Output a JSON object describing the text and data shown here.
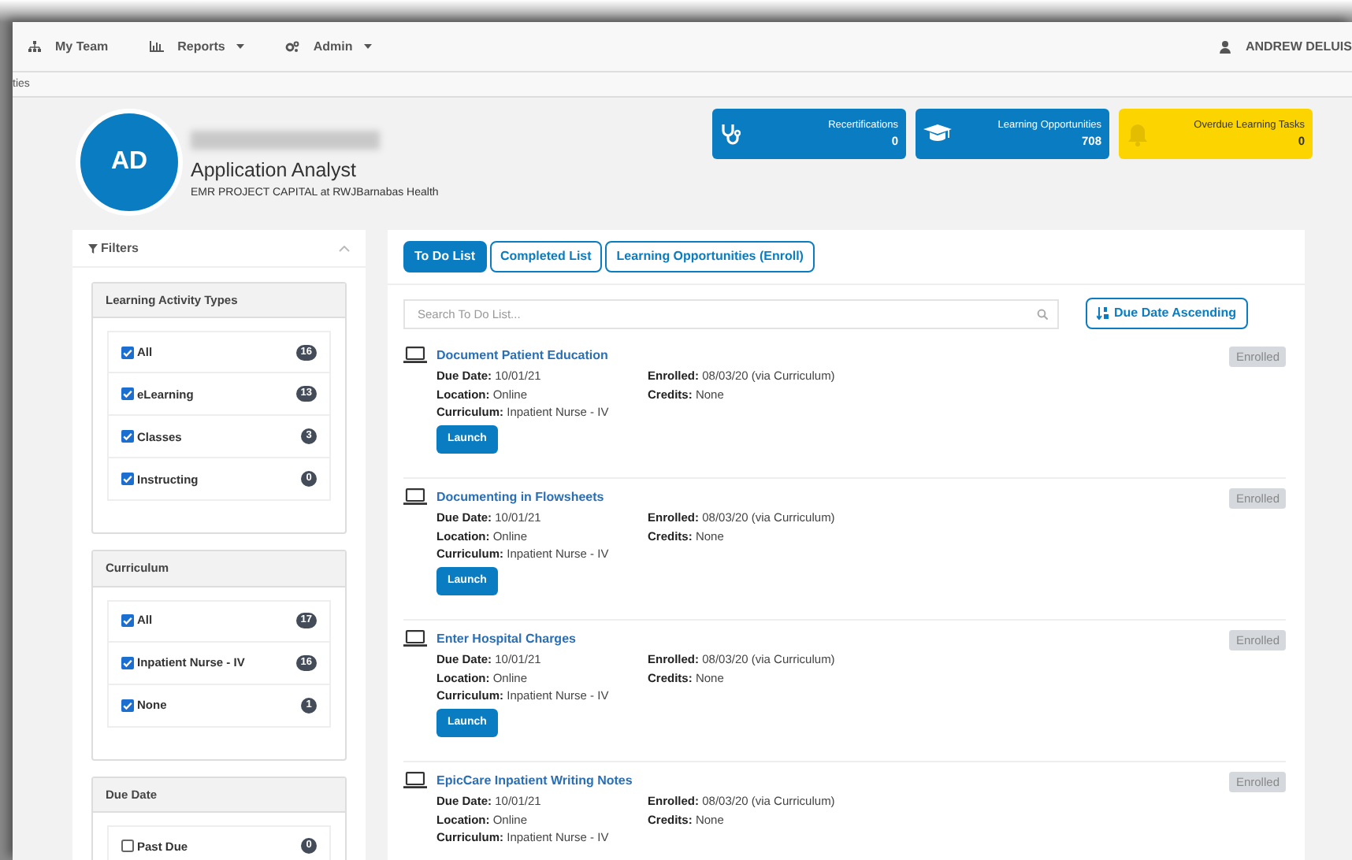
{
  "navbar": {
    "items": [
      {
        "kind": "team",
        "label": "My Team",
        "dropdown": false
      },
      {
        "kind": "reports",
        "label": "Reports",
        "dropdown": true
      },
      {
        "kind": "admin",
        "label": "Admin",
        "dropdown": true
      }
    ],
    "user": "ANDREW DELUIS"
  },
  "breadcrumb": "ties",
  "profile": {
    "initials": "AD",
    "title": "Application Analyst",
    "organization": "EMR PROJECT CAPITAL at RWJBarnabas Health"
  },
  "stats": [
    {
      "kind": "stethoscope",
      "label": "Recertifications",
      "count": "0",
      "color": "#0a7cc1"
    },
    {
      "kind": "cap",
      "label": "Learning Opportunities",
      "count": "708",
      "color": "#0a7cc1"
    },
    {
      "kind": "bell",
      "label": "Overdue Learning Tasks",
      "count": "0",
      "color": "#fcd500"
    }
  ],
  "filters": {
    "title": "Filters",
    "expanded": true,
    "groups": [
      {
        "title": "Learning Activity Types",
        "options": [
          {
            "label": "All",
            "checked": true,
            "count": "16"
          },
          {
            "label": "eLearning",
            "checked": true,
            "count": "13"
          },
          {
            "label": "Classes",
            "checked": true,
            "count": "3"
          },
          {
            "label": "Instructing",
            "checked": true,
            "count": "0"
          }
        ]
      },
      {
        "title": "Curriculum",
        "options": [
          {
            "label": "All",
            "checked": true,
            "count": "17"
          },
          {
            "label": "Inpatient Nurse - IV",
            "checked": true,
            "count": "16"
          },
          {
            "label": "None",
            "checked": true,
            "count": "1"
          }
        ]
      },
      {
        "title": "Due Date",
        "options": [
          {
            "label": "Past Due",
            "checked": false,
            "count": "0"
          }
        ]
      }
    ]
  },
  "tabs": [
    {
      "label": "To Do List",
      "selected": true
    },
    {
      "label": "Completed List",
      "selected": false
    },
    {
      "label": "Learning Opportunities (Enroll)",
      "selected": false
    }
  ],
  "search": {
    "placeholder": "Search To Do List..."
  },
  "sort_button": "Due Date Ascending",
  "items": [
    {
      "title": "Document Patient Education",
      "status": "Enrolled",
      "left": [
        {
          "label": "Due Date:",
          "value": "10/01/21"
        },
        {
          "label": "Location:",
          "value": "Online"
        },
        {
          "label": "Curriculum:",
          "value": "Inpatient Nurse - IV"
        }
      ],
      "right": [
        {
          "label": "Enrolled:",
          "value": "08/03/20 (via Curriculum)"
        },
        {
          "label": "Credits:",
          "value": "None"
        }
      ],
      "action": "Launch"
    },
    {
      "title": "Documenting in Flowsheets",
      "status": "Enrolled",
      "left": [
        {
          "label": "Due Date:",
          "value": "10/01/21"
        },
        {
          "label": "Location:",
          "value": "Online"
        },
        {
          "label": "Curriculum:",
          "value": "Inpatient Nurse - IV"
        }
      ],
      "right": [
        {
          "label": "Enrolled:",
          "value": "08/03/20 (via Curriculum)"
        },
        {
          "label": "Credits:",
          "value": "None"
        }
      ],
      "action": "Launch"
    },
    {
      "title": "Enter Hospital Charges",
      "status": "Enrolled",
      "left": [
        {
          "label": "Due Date:",
          "value": "10/01/21"
        },
        {
          "label": "Location:",
          "value": "Online"
        },
        {
          "label": "Curriculum:",
          "value": "Inpatient Nurse - IV"
        }
      ],
      "right": [
        {
          "label": "Enrolled:",
          "value": "08/03/20 (via Curriculum)"
        },
        {
          "label": "Credits:",
          "value": "None"
        }
      ],
      "action": "Launch"
    },
    {
      "title": "EpicCare Inpatient Writing Notes",
      "status": "Enrolled",
      "left": [
        {
          "label": "Due Date:",
          "value": "10/01/21"
        },
        {
          "label": "Location:",
          "value": "Online"
        },
        {
          "label": "Curriculum:",
          "value": "Inpatient Nurse - IV"
        }
      ],
      "right": [
        {
          "label": "Enrolled:",
          "value": "08/03/20 (via Curriculum)"
        },
        {
          "label": "Credits:",
          "value": "None"
        }
      ]
    }
  ]
}
